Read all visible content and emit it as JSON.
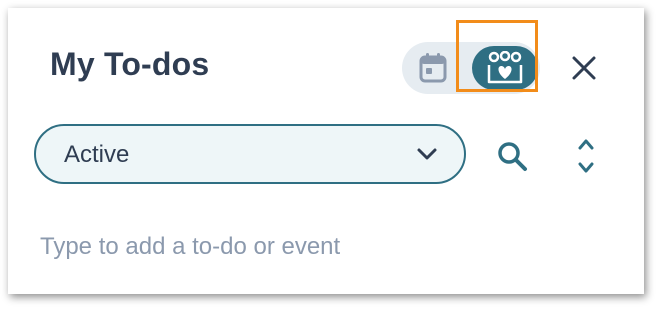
{
  "panel": {
    "title": "My To-dos"
  },
  "view_toggle": {
    "options": [
      {
        "name": "calendar-view",
        "icon": "calendar-icon",
        "selected": false
      },
      {
        "name": "people-view",
        "icon": "people-heart-icon",
        "selected": true
      }
    ]
  },
  "header": {
    "close_icon": "close-icon"
  },
  "filter": {
    "selected": "Active",
    "icon": "chevron-down-icon"
  },
  "toolbar": {
    "search_icon": "search-icon",
    "expand_icon": "expand-collapse-icon"
  },
  "add_todo": {
    "placeholder": "Type to add a to-do or event"
  },
  "colors": {
    "accent": "#2f6f83",
    "title": "#2f3d52",
    "highlight": "#f28c1a",
    "placeholder": "#8b99ad",
    "toggle_track": "#e6ecf1",
    "select_bg": "#eef6f8"
  }
}
